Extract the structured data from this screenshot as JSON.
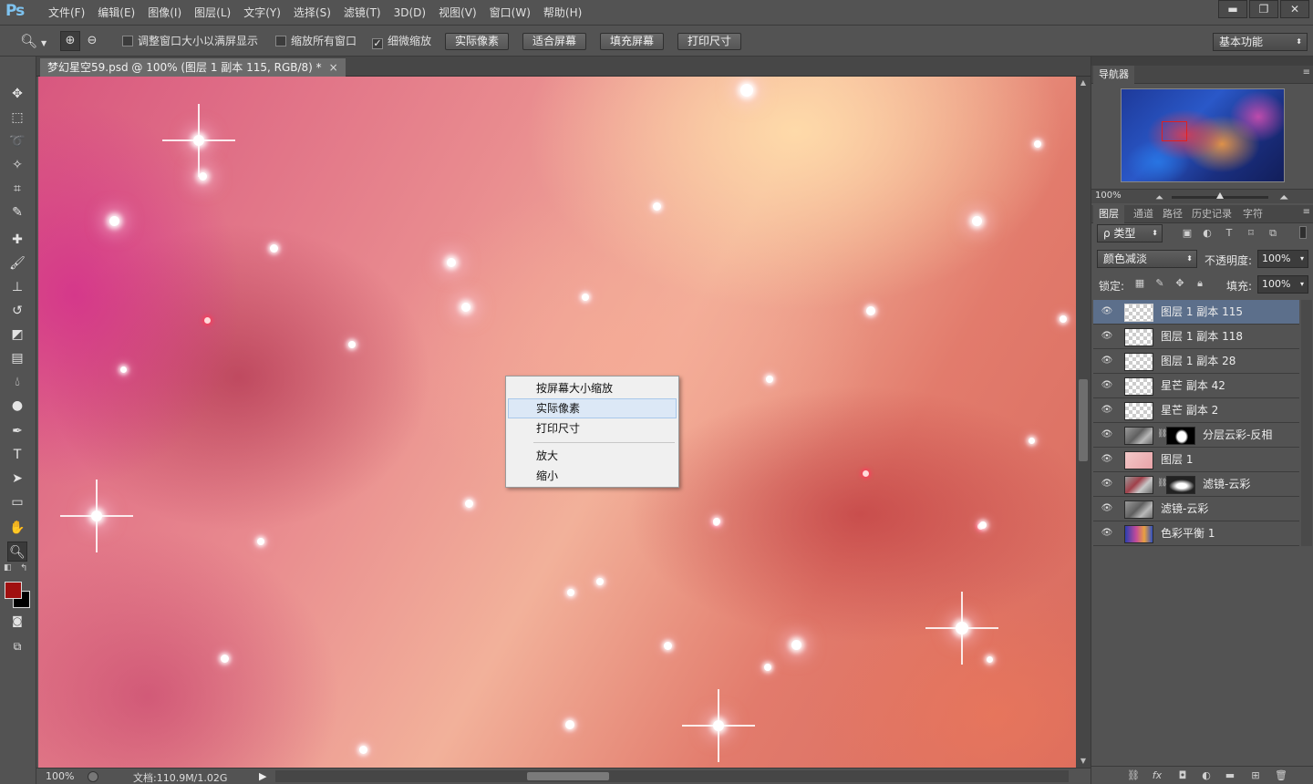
{
  "app": {
    "logo": "Ps"
  },
  "menu": [
    "文件(F)",
    "编辑(E)",
    "图像(I)",
    "图层(L)",
    "文字(Y)",
    "选择(S)",
    "滤镜(T)",
    "3D(D)",
    "视图(V)",
    "窗口(W)",
    "帮助(H)"
  ],
  "window_controls": {
    "minimize": "▬",
    "restore": "❐",
    "close": "✕"
  },
  "options": {
    "tool_icon": "zoom-icon",
    "zoom_in": "⊕",
    "zoom_out": "⊖",
    "resize_windows": {
      "label": "调整窗口大小以满屏显示",
      "checked": false
    },
    "zoom_all_windows": {
      "label": "缩放所有窗口",
      "checked": false
    },
    "scrubby_zoom": {
      "label": "细微缩放",
      "checked": true
    },
    "buttons": [
      "实际像素",
      "适合屏幕",
      "填充屏幕",
      "打印尺寸"
    ],
    "workspace": "基本功能"
  },
  "document": {
    "tab_title": "梦幻星空59.psd @ 100% (图层 1 副本 115, RGB/8) *",
    "close": "×"
  },
  "context_menu": {
    "items": [
      "按屏幕大小缩放",
      "实际像素",
      "打印尺寸",
      "放大",
      "缩小"
    ],
    "highlighted": "实际像素"
  },
  "status": {
    "zoom": "100%",
    "doc_size": "文档:110.9M/1.02G",
    "arrow": "▶"
  },
  "navigator": {
    "tab": "导航器",
    "zoom": "100%"
  },
  "layers_panel": {
    "tabs": [
      "图层",
      "通道",
      "路径",
      "历史记录",
      "字符"
    ],
    "filter_type": "ρ 类型",
    "blend_mode": "颜色减淡",
    "opacity_label": "不透明度:",
    "opacity": "100%",
    "lock_label": "锁定:",
    "fill_label": "填充:",
    "fill": "100%",
    "layers": [
      {
        "name": "图层 1 副本 115",
        "selected": true,
        "thumb": "transparent"
      },
      {
        "name": "图层 1 副本 118",
        "thumb": "transparent"
      },
      {
        "name": "图层 1 副本 28",
        "thumb": "transparent"
      },
      {
        "name": "星芒 副本 42",
        "thumb": "transparent"
      },
      {
        "name": "星芒 副本 2",
        "thumb": "transparent"
      },
      {
        "name": "分层云彩-反相",
        "thumb": "cloud",
        "mask": "white"
      },
      {
        "name": "图层 1",
        "thumb": "pink"
      },
      {
        "name": "滤镜-云彩",
        "thumb": "cloudred",
        "mask": "soft"
      },
      {
        "name": "滤镜-云彩",
        "thumb": "cloud"
      },
      {
        "name": "色彩平衡 1",
        "thumb": "color"
      }
    ]
  },
  "toolbox": [
    "move-icon",
    "marquee-icon",
    "lasso-icon",
    "magic-wand-icon",
    "crop-icon",
    "eyedropper-icon",
    "healing-brush-icon",
    "brush-icon",
    "clone-stamp-icon",
    "history-brush-icon",
    "eraser-icon",
    "gradient-icon",
    "blur-icon",
    "dodge-icon",
    "pen-icon",
    "type-icon",
    "path-select-icon",
    "rectangle-icon",
    "hand-icon",
    "zoom-icon"
  ],
  "colors": {
    "foreground": "#a01010",
    "background": "#000000",
    "accent_selected_layer": "#5c6f8b"
  }
}
